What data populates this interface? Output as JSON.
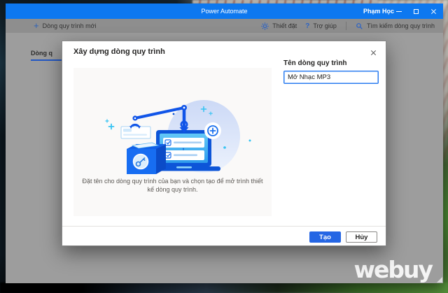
{
  "titlebar": {
    "app_title": "Power Automate",
    "user_name": "Phạm Học"
  },
  "toolbar": {
    "new_flow_label": "Dòng quy trình mới",
    "new_flow_glyph": "+",
    "settings_label": "Thiết đặt",
    "help_label": "Trợ giúp",
    "help_glyph": "?",
    "search_label": "Tìm kiếm dòng quy trình"
  },
  "tabs": {
    "background_tab_visible_label": "Dòng q"
  },
  "dialog": {
    "title": "Xây dựng dòng quy trình",
    "illustration_caption": "Đặt tên cho dòng quy trình của bạn và chọn tạo để mở trình thiết kế dòng quy trình.",
    "name_label": "Tên dòng quy trình",
    "name_value": "Mở Nhạc MP3",
    "create_label": "Tạo",
    "cancel_label": "Hủy"
  },
  "watermark": {
    "text": "webuy"
  },
  "colors": {
    "titlebar_blue": "#0d78f0",
    "primary_button_blue": "#2566e4",
    "tab_underline_blue": "#2257c4",
    "illustration_accent": "#1155e8",
    "illustration_cyan": "#37c4f3"
  }
}
